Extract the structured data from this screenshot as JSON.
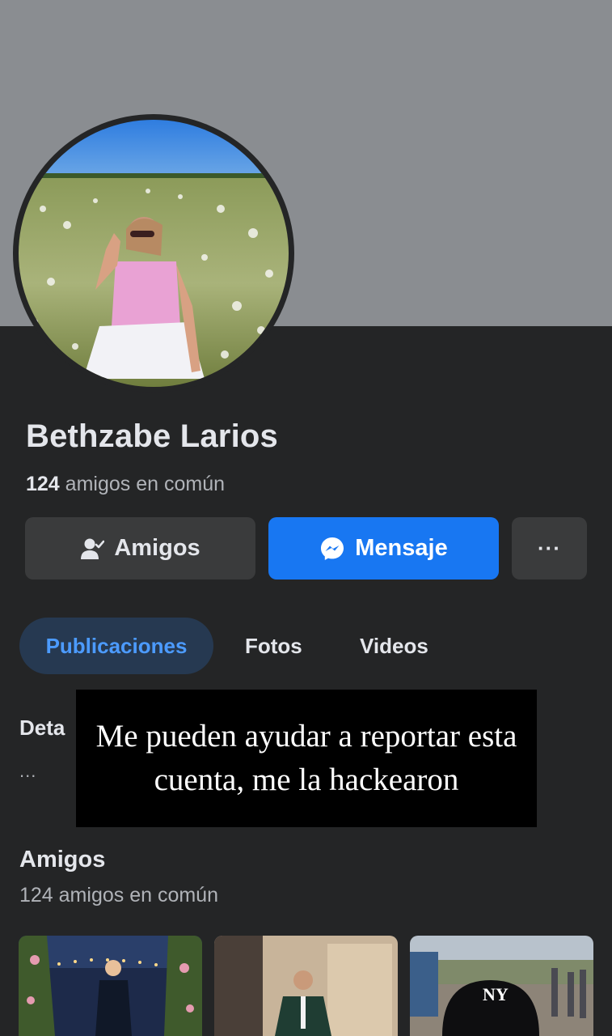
{
  "profile": {
    "name": "Bethzabe Larios",
    "mutual_count": "124",
    "mutual_text": "amigos en común"
  },
  "actions": {
    "friends_label": "Amigos",
    "message_label": "Mensaje",
    "more_label": "···"
  },
  "tabs": [
    {
      "label": "Publicaciones",
      "active": true
    },
    {
      "label": "Fotos",
      "active": false
    },
    {
      "label": "Videos",
      "active": false
    }
  ],
  "details": {
    "label": "Deta",
    "dots": "..."
  },
  "overlay_caption": "Me pueden ayudar a reportar esta cuenta, me la hackearon",
  "friends_section": {
    "title": "Amigos",
    "subtitle": "124 amigos en común",
    "photos": [
      "friend-photo-1",
      "friend-photo-2",
      "friend-photo-3"
    ]
  },
  "colors": {
    "background": "#242526",
    "cover": "#8a8d91",
    "accent_blue": "#1877f2",
    "active_tab_bg": "#263951",
    "active_tab_text": "#4c9bff",
    "button_gray": "#3a3b3c"
  }
}
